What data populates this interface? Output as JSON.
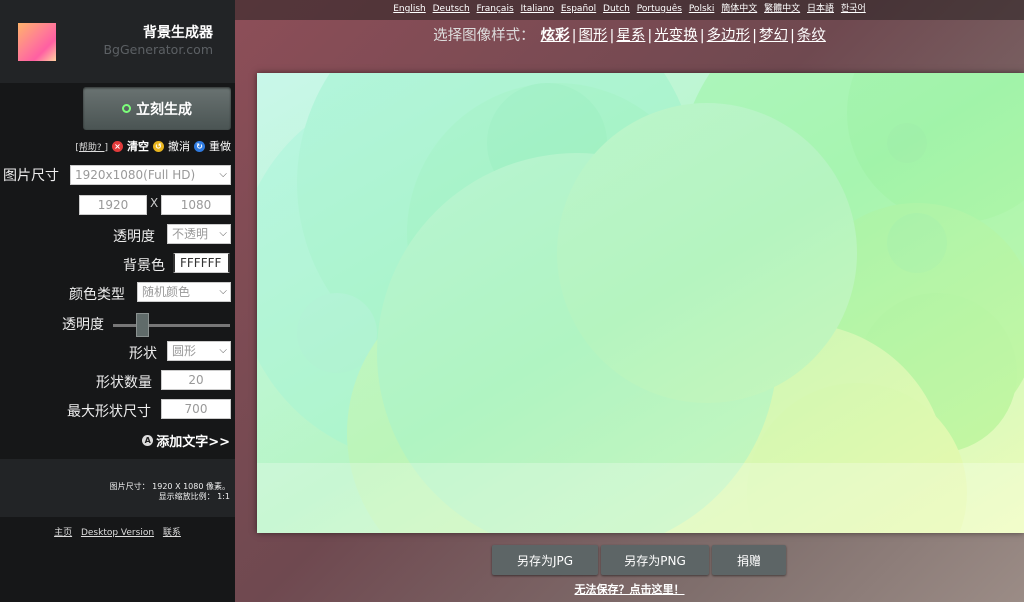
{
  "brand": {
    "title": "背景生成器",
    "subtitle": "BgGenerator.com"
  },
  "generate_button": "立刻生成",
  "toolbar": {
    "help": "[帮助? ]",
    "clear": "清空",
    "undo": "撤消",
    "redo": "重做"
  },
  "form": {
    "image_size_label": "图片尺寸",
    "image_size_value": "1920x1080(Full HD)",
    "width": "1920",
    "x_sep": "X",
    "height": "1080",
    "opacity_label": "透明度",
    "opacity_value": "不透明",
    "bg_color_label": "背景色",
    "bg_color_value": "FFFFFF",
    "color_type_label": "颜色类型",
    "color_type_value": "随机颜色",
    "slider_label": "透明度",
    "slider_level": 0.22,
    "shape_label": "形状",
    "shape_value": "圆形",
    "shape_count_label": "形状数量",
    "shape_count_value": "20",
    "max_size_label": "最大形状尺寸",
    "max_size_value": "700"
  },
  "add_text": "添加文字>>",
  "size_info": {
    "line1": "图片尺寸：   1920 X 1080 像素。",
    "line2": "显示缩放比例：   1:1"
  },
  "footer_links": [
    "主页",
    "Desktop Version",
    "联系"
  ],
  "languages": [
    "English",
    "Deutsch",
    "Français",
    "Italiano",
    "Español",
    "Dutch",
    "Português",
    "Polski",
    "簡体中文",
    "繁體中文",
    "日本語",
    "한국어"
  ],
  "styles": {
    "label": "选择图像样式：",
    "options": [
      "炫彩",
      "图形",
      "星系",
      "光变换",
      "多边形",
      "梦幻",
      "条纹"
    ],
    "active": "炫彩"
  },
  "actions": {
    "save_jpg": "另存为JPG",
    "save_png": "另存为PNG",
    "donate": "捐赠"
  },
  "cannot_save": "无法保存？点击这里！",
  "colors": {
    "accent_green": "#7cff7a",
    "preview_bg": "#ffffff",
    "button": "#5d6566"
  }
}
